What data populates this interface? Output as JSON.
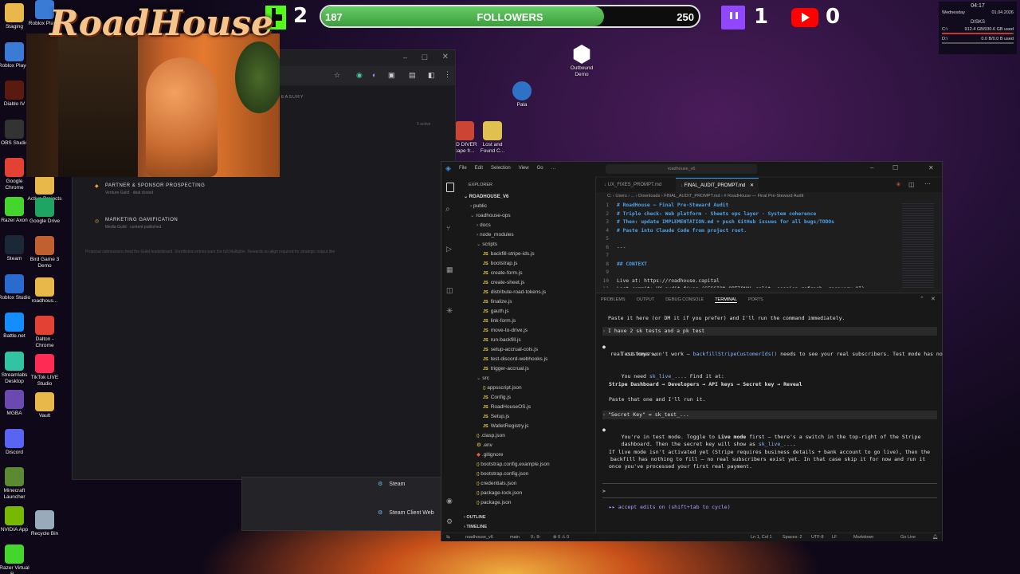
{
  "overlay": {
    "kick_count": "2",
    "followers_current": "187",
    "followers_label": "FOLLOWERS",
    "followers_goal": "250",
    "followers_progress": 0.748,
    "twitch_count": "1",
    "youtube_count": "0",
    "brand_text": "RoadHouse",
    "colors": {
      "kick": "#53fc18",
      "twitch": "#9146ff",
      "youtube": "#ff0000",
      "progress": "#4caf50"
    }
  },
  "system_widget": {
    "time": "04:17",
    "day": "Wednesday",
    "date": "01.04.2026",
    "disks_title": "DISKS",
    "disk_c_label": "C:\\",
    "disk_c_value": "912.4 GB/930.6 GB used",
    "disk_d_label": "D:\\",
    "disk_d_value": "0.0 B/0.0 B used"
  },
  "desktop_icons_left": [
    {
      "label": "Staging",
      "icon": "folder-icon",
      "color": "#e8b84a"
    },
    {
      "label": "Roblox Player",
      "icon": "roblox-icon",
      "color": "#3a7bd5"
    },
    {
      "label": "Diablo IV",
      "icon": "diablo-icon",
      "color": "#5a1a10"
    },
    {
      "label": "OBS Studio",
      "icon": "obs-icon",
      "color": "#333"
    },
    {
      "label": "Google Chrome",
      "icon": "chrome-icon",
      "color": "#e34133"
    },
    {
      "label": "Razer Axon",
      "icon": "razer-icon",
      "color": "#44d62c"
    },
    {
      "label": "Steam",
      "icon": "steam-icon",
      "color": "#1b2838"
    },
    {
      "label": "Roblox Studio",
      "icon": "roblox-studio-icon",
      "color": "#2a6bd0"
    },
    {
      "label": "Battle.net",
      "icon": "battlenet-icon",
      "color": "#148eff"
    },
    {
      "label": "Streamlabs Desktop",
      "icon": "streamlabs-icon",
      "color": "#31c3a2"
    },
    {
      "label": "MGBA",
      "icon": "mgba-icon",
      "color": "#6a4ab0"
    },
    {
      "label": "Discord",
      "icon": "discord-icon",
      "color": "#5865f2"
    },
    {
      "label": "Minecraft Launcher",
      "icon": "minecraft-icon",
      "color": "#5b8a32"
    },
    {
      "label": "NVIDIA App",
      "icon": "nvidia-icon",
      "color": "#76b900"
    },
    {
      "label": "Razer Virtual R...",
      "icon": "razer-virtual-icon",
      "color": "#44d62c"
    }
  ],
  "desktop_icons_col2": [
    {
      "label": "Roblox Player",
      "icon": "roblox-icon",
      "color": "#3a7bd5"
    },
    {
      "label": "Active Projects",
      "icon": "folder-icon",
      "color": "#e8b84a"
    },
    {
      "label": "Google Drive",
      "icon": "gdrive-icon",
      "color": "#1fa463"
    },
    {
      "label": "Bird Game 3 Demo",
      "icon": "bird-game-icon",
      "color": "#c06030"
    },
    {
      "label": "roadhous...",
      "icon": "folder-icon",
      "color": "#e8b84a"
    },
    {
      "label": "Dalton - Chrome",
      "icon": "chrome-icon",
      "color": "#e34133"
    },
    {
      "label": "TikTok LIVE Studio",
      "icon": "tiktok-icon",
      "color": "#fe2c55"
    },
    {
      "label": "Vault",
      "icon": "folder-icon",
      "color": "#e8b84a"
    },
    {
      "label": "Recycle Bin",
      "icon": "recycle-bin-icon",
      "color": "#9ab"
    }
  ],
  "desktop_icons_mid": [
    {
      "label": "Outbound Demo",
      "icon": "outbound-icon"
    },
    {
      "label": "Pala",
      "icon": "pala-icon"
    },
    {
      "label": "HD DIVER cape fr...",
      "icon": "diver-icon"
    },
    {
      "label": "Lost and Found C...",
      "icon": "lost-found-icon"
    }
  ],
  "browser": {
    "section_tag": "EASURY",
    "count_note": "0 active",
    "items": [
      {
        "title": "PARTNER & SPONSOR PROSPECTING",
        "sub": "Venture Guild · deal closed"
      },
      {
        "title": "MARKETING GAMIFICATION",
        "sub": "Media Guild · content published"
      }
    ],
    "note": "Proposal submissions feed the Guild leaderboard. Shortlisted entries earn the full Multiplier. Rewards so align required for strategic output like"
  },
  "taskbar_popup": {
    "items": [
      "Steam",
      "Steam Client Web"
    ]
  },
  "vscode": {
    "menu": [
      "File",
      "Edit",
      "Selection",
      "View",
      "Go",
      "…"
    ],
    "title": "roadhouse_v6",
    "explorer_label": "EXPLORER",
    "root": "ROADHOUSE_V6",
    "tree": [
      {
        "name": "public",
        "depth": 1,
        "type": "folder"
      },
      {
        "name": "roadhouse-ops",
        "depth": 1,
        "type": "folder-open"
      },
      {
        "name": "docs",
        "depth": 2,
        "type": "folder"
      },
      {
        "name": "node_modules",
        "depth": 2,
        "type": "folder"
      },
      {
        "name": "scripts",
        "depth": 2,
        "type": "folder-open"
      },
      {
        "name": "backfill-stripe-ids.js",
        "depth": 3,
        "type": "js"
      },
      {
        "name": "bootstrap.js",
        "depth": 3,
        "type": "js"
      },
      {
        "name": "create-form.js",
        "depth": 3,
        "type": "js"
      },
      {
        "name": "create-sheet.js",
        "depth": 3,
        "type": "js"
      },
      {
        "name": "distribute-road-tokens.js",
        "depth": 3,
        "type": "js"
      },
      {
        "name": "finalize.js",
        "depth": 3,
        "type": "js"
      },
      {
        "name": "gauth.js",
        "depth": 3,
        "type": "js"
      },
      {
        "name": "link-form.js",
        "depth": 3,
        "type": "js"
      },
      {
        "name": "move-to-drive.js",
        "depth": 3,
        "type": "js"
      },
      {
        "name": "run-backfill.js",
        "depth": 3,
        "type": "js"
      },
      {
        "name": "setup-accrual-cols.js",
        "depth": 3,
        "type": "js"
      },
      {
        "name": "test-discord-webhooks.js",
        "depth": 3,
        "type": "js"
      },
      {
        "name": "trigger-accrual.js",
        "depth": 3,
        "type": "js"
      },
      {
        "name": "src",
        "depth": 2,
        "type": "folder-open"
      },
      {
        "name": "appsscript.json",
        "depth": 3,
        "type": "json"
      },
      {
        "name": "Config.js",
        "depth": 3,
        "type": "js"
      },
      {
        "name": "RoadHouseOS.js",
        "depth": 3,
        "type": "js"
      },
      {
        "name": "Setup.js",
        "depth": 3,
        "type": "js"
      },
      {
        "name": "WalletRegistry.js",
        "depth": 3,
        "type": "js"
      },
      {
        "name": ".clasp.json",
        "depth": 2,
        "type": "json"
      },
      {
        "name": ".env",
        "depth": 2,
        "type": "env"
      },
      {
        "name": ".gitignore",
        "depth": 2,
        "type": "git"
      },
      {
        "name": "bootstrap.config.example.json",
        "depth": 2,
        "type": "json"
      },
      {
        "name": "bootstrap.config.json",
        "depth": 2,
        "type": "json"
      },
      {
        "name": "credentials.json",
        "depth": 2,
        "type": "json"
      },
      {
        "name": "package-lock.json",
        "depth": 2,
        "type": "json"
      },
      {
        "name": "package.json",
        "depth": 2,
        "type": "json"
      }
    ],
    "outline_label": "OUTLINE",
    "timeline_label": "TIMELINE",
    "tabs": [
      {
        "label": "UX_FIXES_PROMPT.md",
        "active": false
      },
      {
        "label": "FINAL_AUDIT_PROMPT.md",
        "active": true
      }
    ],
    "breadcrumb": "C: › Users › ... › Downloads › FINAL_AUDIT_PROMPT.md › # RoadHouse — Final Pre-Steward Audit",
    "editor_lines": [
      {
        "n": "1",
        "text": "# RoadHouse — Final Pre-Steward Audit",
        "kind": "h"
      },
      {
        "n": "2",
        "text": "# Triple check: Web platform · Sheets ops layer · System coherence",
        "kind": "h"
      },
      {
        "n": "3",
        "text": "# Then: update IMPLEMENTATION.md + push GitHub issues for all bugs/TODOs",
        "kind": "h"
      },
      {
        "n": "4",
        "text": "# Paste into Claude Code from project root.",
        "kind": "h"
      },
      {
        "n": "5",
        "text": "",
        "kind": "t"
      },
      {
        "n": "6",
        "text": "---",
        "kind": "t"
      },
      {
        "n": "7",
        "text": "",
        "kind": "t"
      },
      {
        "n": "8",
        "text": "## CONTEXT",
        "kind": "h2"
      },
      {
        "n": "9",
        "text": "",
        "kind": "t"
      },
      {
        "n": "10",
        "text": "Live at: https://roadhouse.capital",
        "kind": "t"
      },
      {
        "n": "11",
        "text": "Last commit: UX audit fixes (SESSION_OPTIONAL split, session refresh, recovery UI)",
        "kind": "t"
      }
    ],
    "panel_tabs": [
      "PROBLEMS",
      "OUTPUT",
      "DEBUG CONSOLE",
      "TERMINAL",
      "PORTS"
    ],
    "active_panel": "TERMINAL",
    "terminal": {
      "l1": "Paste it here (or DM it if you prefer) and I'll run the command immediately.",
      "user1": "I have 2 sk tests and a pk test",
      "a1_pre": "Test keys won't work — ",
      "a1_code": "backfillStripeCustomerIds()",
      "a1_post": " needs to see your real subscribers. Test mode has no",
      "a1_l2": "real customers.",
      "a2_pre": "You need ",
      "a2_code": "sk_live_...",
      "a2_post": ". Find it at:",
      "a3": "Stripe Dashboard → Developers → API keys → Secret key → Reveal",
      "a4": "Paste that one and I'll run it.",
      "user2": "\"Secret Key\" = sk_test_...",
      "b1_pre": "You're in test mode. Toggle to ",
      "b1_bold": "Live mode",
      "b1_post": " first — there's a switch in the top-right of the Stripe",
      "b2_pre": "dashboard. Then the secret key will show as ",
      "b2_code": "sk_live_...",
      "b2_post": ".",
      "c1": "If live mode isn't activated yet (Stripe requires business details + bank account to go live), then the",
      "c2": "backfill has nothing to fill — no real subscribers exist yet. In that case skip it for now and run it",
      "c3": "once you've processed your first real payment.",
      "prompt": ">",
      "footer": "▸▸ accept edits on (shift+tab to cycle)"
    },
    "status": {
      "repo": "roadhouse_v6",
      "branch": "main",
      "sync": "0↓ 8↑",
      "problems": "⊗ 0 ⚠ 0",
      "pos": "Ln 1, Col 1",
      "spaces": "Spaces: 2",
      "enc": "UTF-8",
      "eol": "LF",
      "lang": "Markdown",
      "live": "Go Live"
    }
  }
}
